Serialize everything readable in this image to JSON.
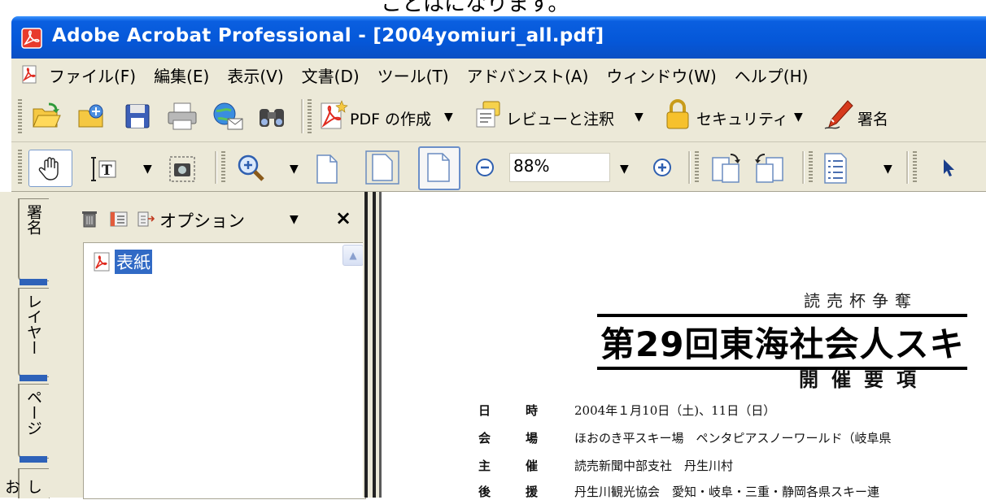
{
  "caption_fragment": "ことはになります。",
  "window": {
    "title": "Adobe Acrobat Professional - [2004yomiuri_all.pdf]"
  },
  "menu": {
    "items": [
      "ファイル(F)",
      "編集(E)",
      "表示(V)",
      "文書(D)",
      "ツール(T)",
      "アドバンスト(A)",
      "ウィンドウ(W)",
      "ヘルプ(H)"
    ]
  },
  "toolbar1": {
    "create_pdf": "PDF の作成",
    "review": "レビューと注釈",
    "security": "セキュリティ",
    "sign": "署名"
  },
  "toolbar2": {
    "zoom_value": "88%"
  },
  "left_panel": {
    "options_label": "オプション",
    "close_glyph": "×",
    "bookmark_label": "表紙",
    "tabs": [
      "署名",
      "レイヤー",
      "ページ",
      "しお"
    ]
  },
  "document": {
    "subtitle": "読売杯争奪",
    "title": "第29回東海社会人スキ",
    "heading": "開催要項",
    "rows": [
      {
        "k1": "日",
        "k2": "時",
        "v": "2004年１月10日（土)、11日（日）"
      },
      {
        "k1": "会",
        "k2": "場",
        "v": "ほおのき平スキー場　ペンタピアスノーワールド（岐阜県"
      },
      {
        "k1": "主",
        "k2": "催",
        "v": "読売新聞中部支社　丹生川村"
      },
      {
        "k1": "後",
        "k2": "援",
        "v": "丹生川観光協会　愛知・岐阜・三重・静岡各県スキー連"
      }
    ]
  },
  "colors": {
    "titlebar": "#0557d8",
    "chrome": "#ece9d8",
    "selection": "#316ac5"
  }
}
